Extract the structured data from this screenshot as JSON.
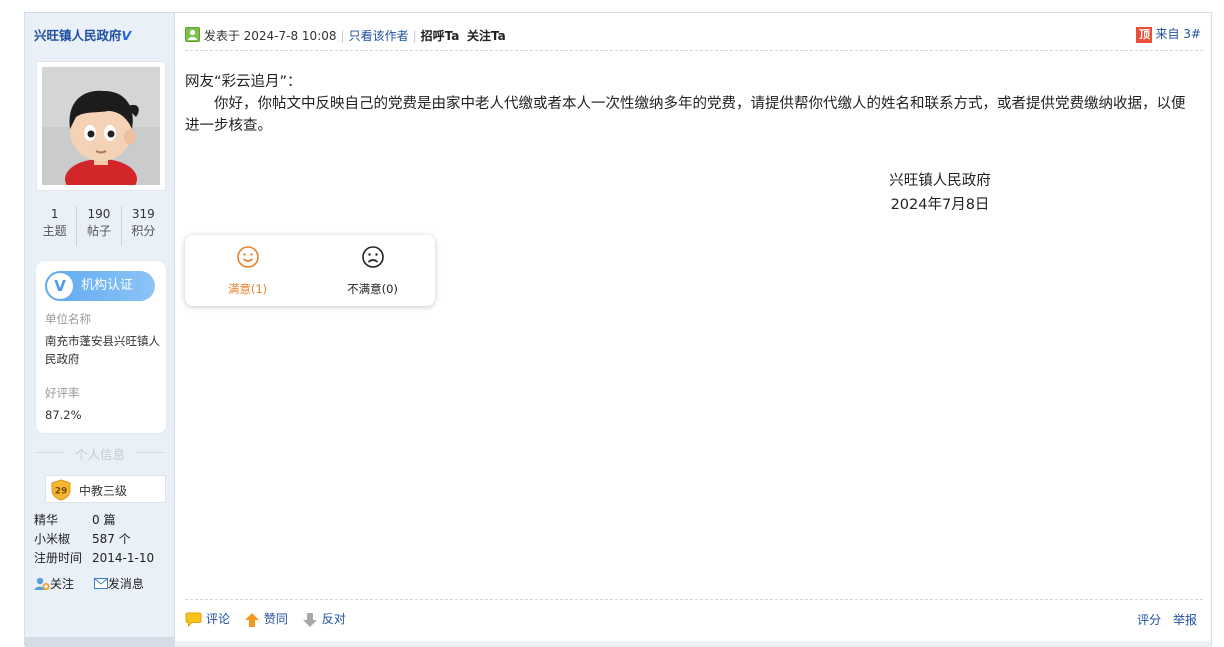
{
  "author": {
    "name": "兴旺镇人民政府",
    "vip_mark": "V",
    "stats": [
      {
        "value": "1",
        "label": "主题"
      },
      {
        "value": "190",
        "label": "帖子"
      },
      {
        "value": "319",
        "label": "积分"
      }
    ],
    "cert": {
      "badge_icon": "V",
      "badge_label": "机构认证",
      "unit_label": "单位名称",
      "unit_value": "南充市蓬安县兴旺镇人民政府",
      "rate_label": "好评率",
      "rate_value": "87.2%"
    },
    "section_title": "个人信息",
    "level": {
      "number": "29",
      "name": "中教三级"
    },
    "info": [
      {
        "key": "精华",
        "value": "0 篇"
      },
      {
        "key": "小米椒",
        "value": "587 个"
      },
      {
        "key": "注册时间",
        "value": "2014-1-10"
      }
    ],
    "follow_label": "关注",
    "message_label": "发消息"
  },
  "post": {
    "posted_text": "发表于 2024-7-8 10:08",
    "only_author": "只看该作者",
    "greet": "招呼Ta",
    "follow": "关注Ta",
    "floor_icon": "顶",
    "floor_text": "来自 3#",
    "greeting_line": "网友“彩云追月”：",
    "body": "你好，你帖文中反映自己的党费是由家中老人代缴或者本人一次性缴纳多年的党费，请提供帮你代缴人的姓名和联系方式，或者提供党费缴纳收据，以便进一步核查。",
    "signature_org": "兴旺镇人民政府",
    "signature_date": "2024年7月8日",
    "rating": {
      "satisfied": "满意(1)",
      "unsatisfied": "不满意(0)",
      "satisfied_color": "#e9822c"
    },
    "footer": {
      "comment": "评论",
      "agree": "赞同",
      "oppose": "反对",
      "score": "评分",
      "report": "举报"
    }
  },
  "colors": {
    "link": "#1f4fa0",
    "sidebar_bg": "#e9f0f8",
    "accent_orange": "#f39a1e"
  }
}
